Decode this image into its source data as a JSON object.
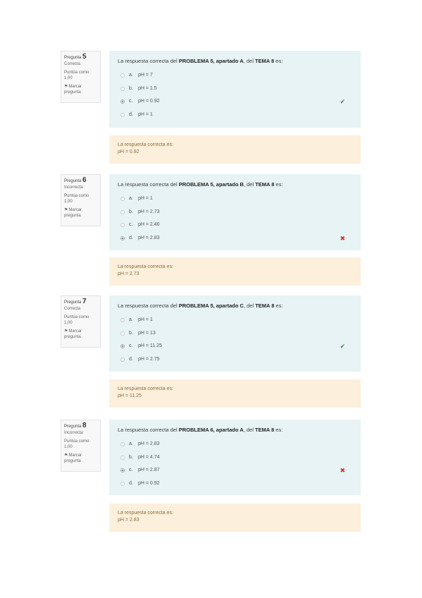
{
  "colors": {
    "formulation_bg": "#e7f3f5",
    "feedback_bg": "#fcefdc",
    "correct": "#3a8a3a",
    "incorrect": "#d9342b"
  },
  "questions": [
    {
      "qlabel": "Pregunta",
      "number": "5",
      "status": "Correcta",
      "grade": "Puntúa como 1,00",
      "flag": "Marcar pregunta",
      "text_pre": "La respuesta correcta del ",
      "text_bold1": "PROBLEMA 5, apartado A",
      "text_mid": ", del ",
      "text_bold2": "TEMA 8",
      "text_post": " es:",
      "options": [
        {
          "letter": "a.",
          "text": "pH = 7"
        },
        {
          "letter": "b.",
          "text": "pH = 1.5"
        },
        {
          "letter": "c.",
          "text": "pH = 0.92"
        },
        {
          "letter": "d.",
          "text": "pH = 1"
        }
      ],
      "selected": 2,
      "result": "correct",
      "feedback_label": "La respuesta correcta es:",
      "feedback_answer": "pH = 0.92"
    },
    {
      "qlabel": "Pregunta",
      "number": "6",
      "status": "Incorrecta",
      "grade": "Puntúa como 1,00",
      "flag": "Marcar pregunta",
      "text_pre": "La respuesta correcta del ",
      "text_bold1": "PROBLEMA 5, apartado B",
      "text_mid": ", del ",
      "text_bold2": "TEMA 8",
      "text_post": " es:",
      "options": [
        {
          "letter": "a.",
          "text": "pH = 1"
        },
        {
          "letter": "b.",
          "text": "pH = 2.73"
        },
        {
          "letter": "c.",
          "text": "pH = 2.46"
        },
        {
          "letter": "d.",
          "text": "pH = 2.83"
        }
      ],
      "selected": 3,
      "result": "incorrect",
      "feedback_label": "La respuesta correcta es:",
      "feedback_answer": "pH = 2.73"
    },
    {
      "qlabel": "Pregunta",
      "number": "7",
      "status": "Correcta",
      "grade": "Puntúa como 1,00",
      "flag": "Marcar pregunta",
      "text_pre": "La respuesta correcta del ",
      "text_bold1": "PROBLEMA 5, apartado C",
      "text_mid": ", del ",
      "text_bold2": "TEMA 8",
      "text_post": " es:",
      "options": [
        {
          "letter": "a.",
          "text": "pH = 1"
        },
        {
          "letter": "b.",
          "text": "pH = 13"
        },
        {
          "letter": "c.",
          "text": "pH = 11.25"
        },
        {
          "letter": "d.",
          "text": "pH = 2.75"
        }
      ],
      "selected": 2,
      "result": "correct",
      "feedback_label": "La respuesta correcta es:",
      "feedback_answer": "pH = 11.25"
    },
    {
      "qlabel": "Pregunta",
      "number": "8",
      "status": "Incorrecta",
      "grade": "Puntúa como 1,00",
      "flag": "Marcar pregunta",
      "text_pre": "La respuesta correcta del ",
      "text_bold1": "PROBLEMA 6, apartado A",
      "text_mid": ", del ",
      "text_bold2": "TEMA 8",
      "text_post": " es:",
      "options": [
        {
          "letter": "a.",
          "text": "pH = 2.83"
        },
        {
          "letter": "b.",
          "text": "pH = 4.74"
        },
        {
          "letter": "c.",
          "text": "pH = 2.87"
        },
        {
          "letter": "d.",
          "text": "pH = 0.92"
        }
      ],
      "selected": 2,
      "result": "incorrect",
      "feedback_label": "La respuesta correcta es:",
      "feedback_answer": "pH = 2.83"
    }
  ]
}
